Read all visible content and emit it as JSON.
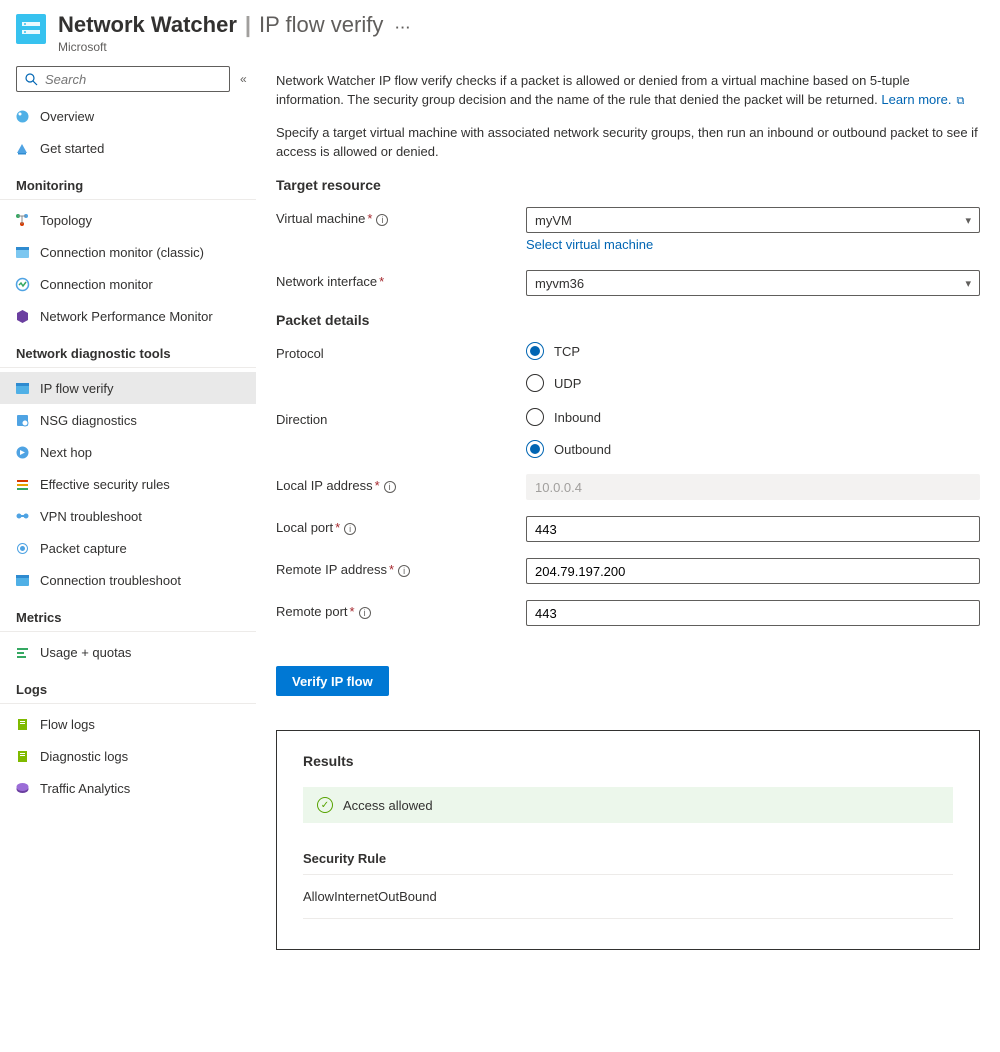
{
  "header": {
    "title": "Network Watcher",
    "subtitle": "IP flow verify",
    "vendor": "Microsoft"
  },
  "search": {
    "placeholder": "Search"
  },
  "sidebar": {
    "top": [
      {
        "label": "Overview"
      },
      {
        "label": "Get started"
      }
    ],
    "groups": [
      {
        "label": "Monitoring",
        "items": [
          {
            "label": "Topology"
          },
          {
            "label": "Connection monitor (classic)"
          },
          {
            "label": "Connection monitor"
          },
          {
            "label": "Network Performance Monitor"
          }
        ]
      },
      {
        "label": "Network diagnostic tools",
        "items": [
          {
            "label": "IP flow verify",
            "selected": true
          },
          {
            "label": "NSG diagnostics"
          },
          {
            "label": "Next hop"
          },
          {
            "label": "Effective security rules"
          },
          {
            "label": "VPN troubleshoot"
          },
          {
            "label": "Packet capture"
          },
          {
            "label": "Connection troubleshoot"
          }
        ]
      },
      {
        "label": "Metrics",
        "items": [
          {
            "label": "Usage + quotas"
          }
        ]
      },
      {
        "label": "Logs",
        "items": [
          {
            "label": "Flow logs"
          },
          {
            "label": "Diagnostic logs"
          },
          {
            "label": "Traffic Analytics"
          }
        ]
      }
    ]
  },
  "main": {
    "desc1": "Network Watcher IP flow verify checks if a packet is allowed or denied from a virtual machine based on 5-tuple information. The security group decision and the name of the rule that denied the packet will be returned. ",
    "learn_more": "Learn more.",
    "desc2": "Specify a target virtual machine with associated network security groups, then run an inbound or outbound packet to see if access is allowed or denied.",
    "target_section": "Target resource",
    "vm_label": "Virtual machine",
    "vm_value": "myVM",
    "vm_link": "Select virtual machine",
    "ni_label": "Network interface",
    "ni_value": "myvm36",
    "packet_section": "Packet details",
    "protocol_label": "Protocol",
    "protocol_tcp": "TCP",
    "protocol_udp": "UDP",
    "direction_label": "Direction",
    "direction_in": "Inbound",
    "direction_out": "Outbound",
    "local_ip_label": "Local IP address",
    "local_ip_value": "10.0.0.4",
    "local_port_label": "Local port",
    "local_port_value": "443",
    "remote_ip_label": "Remote IP address",
    "remote_ip_value": "204.79.197.200",
    "remote_port_label": "Remote port",
    "remote_port_value": "443",
    "verify_btn": "Verify IP flow",
    "results_title": "Results",
    "status_text": "Access allowed",
    "rule_title": "Security Rule",
    "rule_name": "AllowInternetOutBound"
  }
}
